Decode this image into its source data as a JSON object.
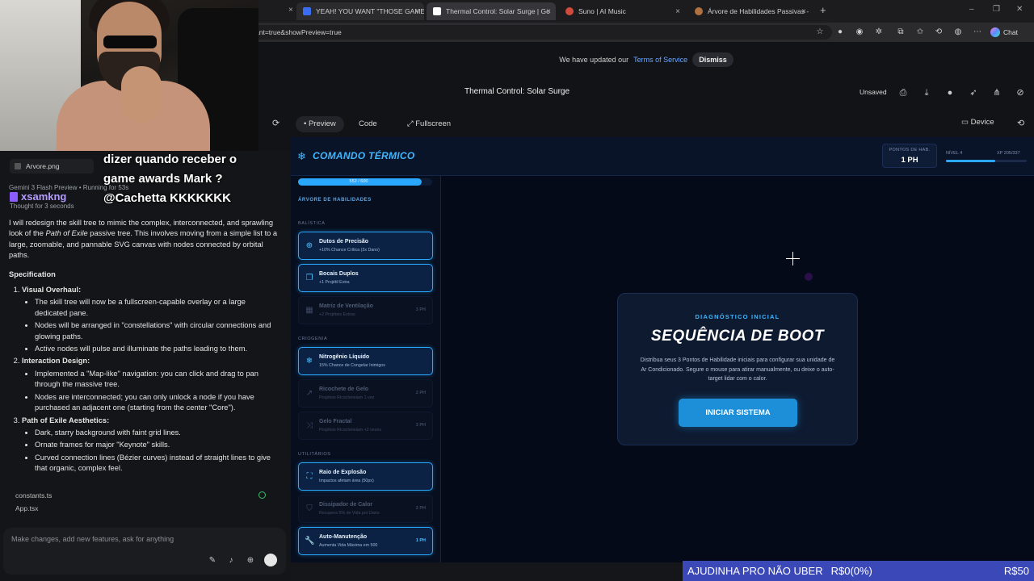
{
  "browser": {
    "tabs": [
      {
        "label": "YEAH! YOU WANT \"THOSE GAMES",
        "fav": "#3a6df0"
      },
      {
        "label": "Thermal Control: Solar Surge | Go",
        "fav": "#ffffff"
      },
      {
        "label": "Suno | AI Music",
        "fav": "#d04b3a"
      },
      {
        "label": "Árvore de Habilidades Passivas - C",
        "fav": "#b07040"
      }
    ],
    "url": "ant=true&showPreview=true",
    "chat_label": "Chat"
  },
  "app": {
    "tos_text": "We have updated our",
    "tos_link": "Terms of Service",
    "dismiss": "Dismiss",
    "title": "Thermal Control: Solar Surge",
    "unsaved": "Unsaved",
    "tabs": {
      "preview": "Preview",
      "code": "Code",
      "fullscreen": "Fullscreen"
    },
    "device": "Device"
  },
  "stream": {
    "overlay_line1": "dizer quando receber o",
    "overlay_line2": "game awards Mark ?",
    "overlay_line3": "@Cachetta KKKKKKK",
    "username": "xsamkng",
    "ticker_label": "AJUDINHA PRO NÃO UBER",
    "ticker_amount": "R$0(0%)",
    "ticker_goal": "R$50"
  },
  "chat": {
    "attachment": "Arvore.png",
    "model": "Gemini 3 Flash Preview",
    "running": "Running for 53s",
    "thought": "Thought for 3 seconds",
    "intro_a": "I will redesign the skill tree to mimic the complex, interconnected, and sprawling look of the ",
    "intro_em": "Path of Exile",
    "intro_b": " passive tree. This involves moving from a simple list to a large, zoomable, and pannable SVG canvas with nodes connected by orbital paths.",
    "spec_heading": "Specification",
    "sections": [
      {
        "title": "Visual Overhaul",
        "items": [
          "The skill tree will now be a fullscreen-capable overlay or a large dedicated pane.",
          "Nodes will be arranged in \"constellations\" with circular connections and glowing paths.",
          "Active nodes will pulse and illuminate the paths leading to them."
        ]
      },
      {
        "title": "Interaction Design",
        "items": [
          "Implemented a \"Map-like\" navigation: you can click and drag to pan through the massive tree.",
          "Nodes are interconnected; you can only unlock a node if you have purchased an adjacent one (starting from the center \"Core\")."
        ]
      },
      {
        "title": "Path of Exile Aesthetics",
        "items": [
          "Dark, starry background with faint grid lines.",
          "Ornate frames for major \"Keynote\" skills.",
          "Curved connection lines (Bézier curves) instead of straight lines to give that organic, complex feel."
        ]
      }
    ],
    "files": [
      "constants.ts",
      "App.tsx"
    ],
    "prompt_placeholder": "Make changes, add new features, ask for anything"
  },
  "game": {
    "title": "COMANDO TÉRMICO",
    "points_label": "PONTOS DE HAB.",
    "points_value": "1 PH",
    "level": "NÍVEL 4",
    "xp": "XP 205/337",
    "xp_fraction": 0.61,
    "hp_text": "552 / 600",
    "hp_fraction": 0.92,
    "tree_heading": "ÁRVORE DE HABILIDADES",
    "categories": [
      {
        "label": "BALÍSTICA",
        "skills": [
          {
            "name": "Dutos de Precisão",
            "desc": "+10% Chance Crítica (3x Dano)",
            "cost": "",
            "active": true,
            "icon": "crosshair-icon",
            "glyph": "⊕"
          },
          {
            "name": "Bocais Duplos",
            "desc": "+1 Projétil Extra",
            "cost": "",
            "active": true,
            "icon": "copy-icon",
            "glyph": "❐"
          },
          {
            "name": "Matriz de Ventilação",
            "desc": "+2 Projéteis Extras",
            "cost": "3 PH",
            "active": false,
            "icon": "grid-icon",
            "glyph": "▦"
          }
        ]
      },
      {
        "label": "CRIOGENIA",
        "skills": [
          {
            "name": "Nitrogênio Líquido",
            "desc": "15% Chance de Congelar Inimigos",
            "cost": "",
            "active": true,
            "icon": "snowflake-icon",
            "glyph": "❄"
          },
          {
            "name": "Ricochete de Gelo",
            "desc": "Projéteis Ricocheteiam 1 vez",
            "cost": "2 PH",
            "active": false,
            "icon": "bounce-icon",
            "glyph": "↗"
          },
          {
            "name": "Gelo Fractal",
            "desc": "Projéteis Ricocheteiam +2 vezes",
            "cost": "3 PH",
            "active": false,
            "icon": "shuffle-icon",
            "glyph": "⤨"
          }
        ]
      },
      {
        "label": "UTILITÁRIOS",
        "skills": [
          {
            "name": "Raio de Explosão",
            "desc": "Impactos afetam área (50px)",
            "cost": "",
            "active": true,
            "icon": "expand-icon",
            "glyph": "⛶"
          },
          {
            "name": "Dissipador de Calor",
            "desc": "Recupera 5% de Vida por Dano",
            "cost": "2 PH",
            "active": false,
            "icon": "shield-icon",
            "glyph": "⛉"
          },
          {
            "name": "Auto-Manutenção",
            "desc": "Aumenta Vida Máxima em 500",
            "cost": "1 PH",
            "active": true,
            "icon": "wrench-icon",
            "glyph": "🔧"
          }
        ]
      }
    ],
    "boot": {
      "subtitle": "DIAGNÓSTICO INICIAL",
      "title": "SEQUÊNCIA DE BOOT",
      "desc": "Distribua seus 3 Pontos de Habilidade iniciais para configurar sua unidade de Ar Condicionado. Segure o mouse para atirar manualmente, ou deixe o auto-target lidar com o calor.",
      "button": "INICIAR SISTEMA"
    }
  }
}
